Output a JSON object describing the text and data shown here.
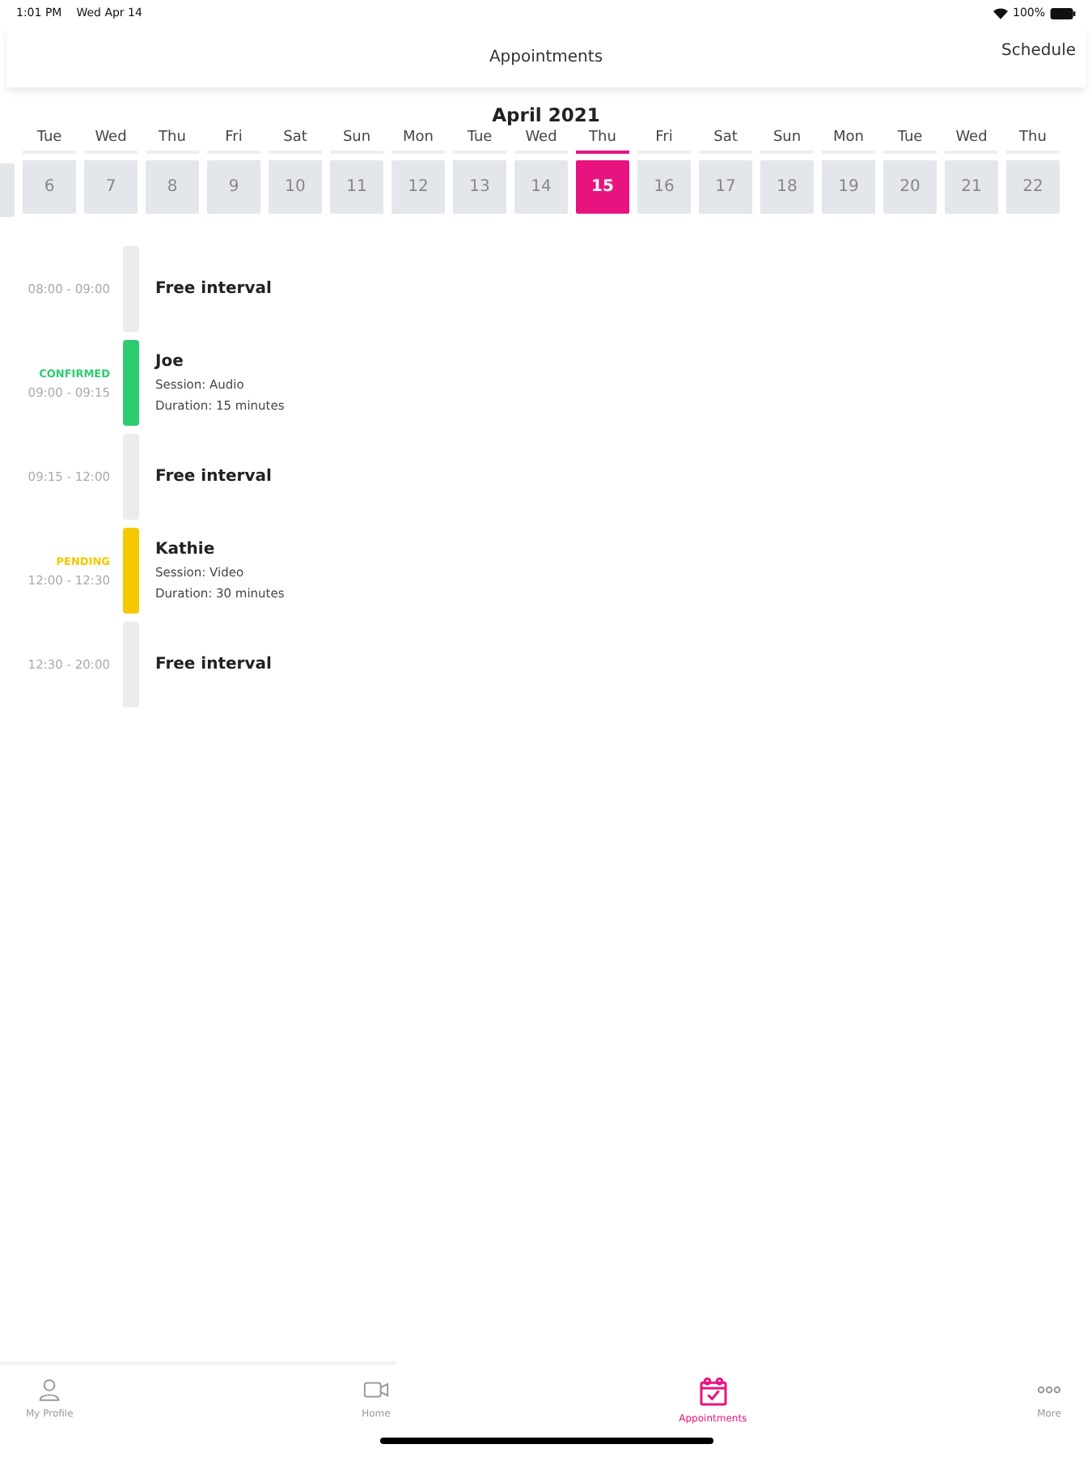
{
  "status_bar": {
    "time": "1:01 PM",
    "date": "Wed Apr 14",
    "battery": "100%"
  },
  "nav": {
    "title": "Appointments",
    "action": "Schedule"
  },
  "calendar": {
    "month": "April 2021",
    "days": [
      {
        "day": "Tue",
        "date": "6",
        "selected": false
      },
      {
        "day": "Wed",
        "date": "7",
        "selected": false
      },
      {
        "day": "Thu",
        "date": "8",
        "selected": false
      },
      {
        "day": "Fri",
        "date": "9",
        "selected": false
      },
      {
        "day": "Sat",
        "date": "10",
        "selected": false
      },
      {
        "day": "Sun",
        "date": "11",
        "selected": false
      },
      {
        "day": "Mon",
        "date": "12",
        "selected": false
      },
      {
        "day": "Tue",
        "date": "13",
        "selected": false
      },
      {
        "day": "Wed",
        "date": "14",
        "selected": false
      },
      {
        "day": "Thu",
        "date": "15",
        "selected": true
      },
      {
        "day": "Fri",
        "date": "16",
        "selected": false
      },
      {
        "day": "Sat",
        "date": "17",
        "selected": false
      },
      {
        "day": "Sun",
        "date": "18",
        "selected": false
      },
      {
        "day": "Mon",
        "date": "19",
        "selected": false
      },
      {
        "day": "Tue",
        "date": "20",
        "selected": false
      },
      {
        "day": "Wed",
        "date": "21",
        "selected": false
      },
      {
        "day": "Thu",
        "date": "22",
        "selected": false
      }
    ]
  },
  "schedule": [
    {
      "kind": "free",
      "time": "08:00 - 09:00",
      "title": "Free interval"
    },
    {
      "kind": "appointment",
      "status": "CONFIRMED",
      "color": "#2ecc71",
      "time": "09:00 - 09:15",
      "name": "Joe",
      "session": "Session: Audio",
      "duration": "Duration: 15 minutes"
    },
    {
      "kind": "free",
      "time": "09:15 - 12:00",
      "title": "Free interval"
    },
    {
      "kind": "appointment",
      "status": "PENDING",
      "color": "#f5c800",
      "time": "12:00 - 12:30",
      "name": "Kathie",
      "session": "Session: Video",
      "duration": "Duration: 30 minutes"
    },
    {
      "kind": "free",
      "time": "12:30 - 20:00",
      "title": "Free interval"
    }
  ],
  "tab_bar": [
    {
      "kind": "profile",
      "label": "My Profile",
      "selected": false
    },
    {
      "kind": "home",
      "label": "Home",
      "selected": false
    },
    {
      "kind": "appointments",
      "label": "Appointments",
      "selected": true
    },
    {
      "kind": "more",
      "label": "More",
      "selected": false
    }
  ]
}
